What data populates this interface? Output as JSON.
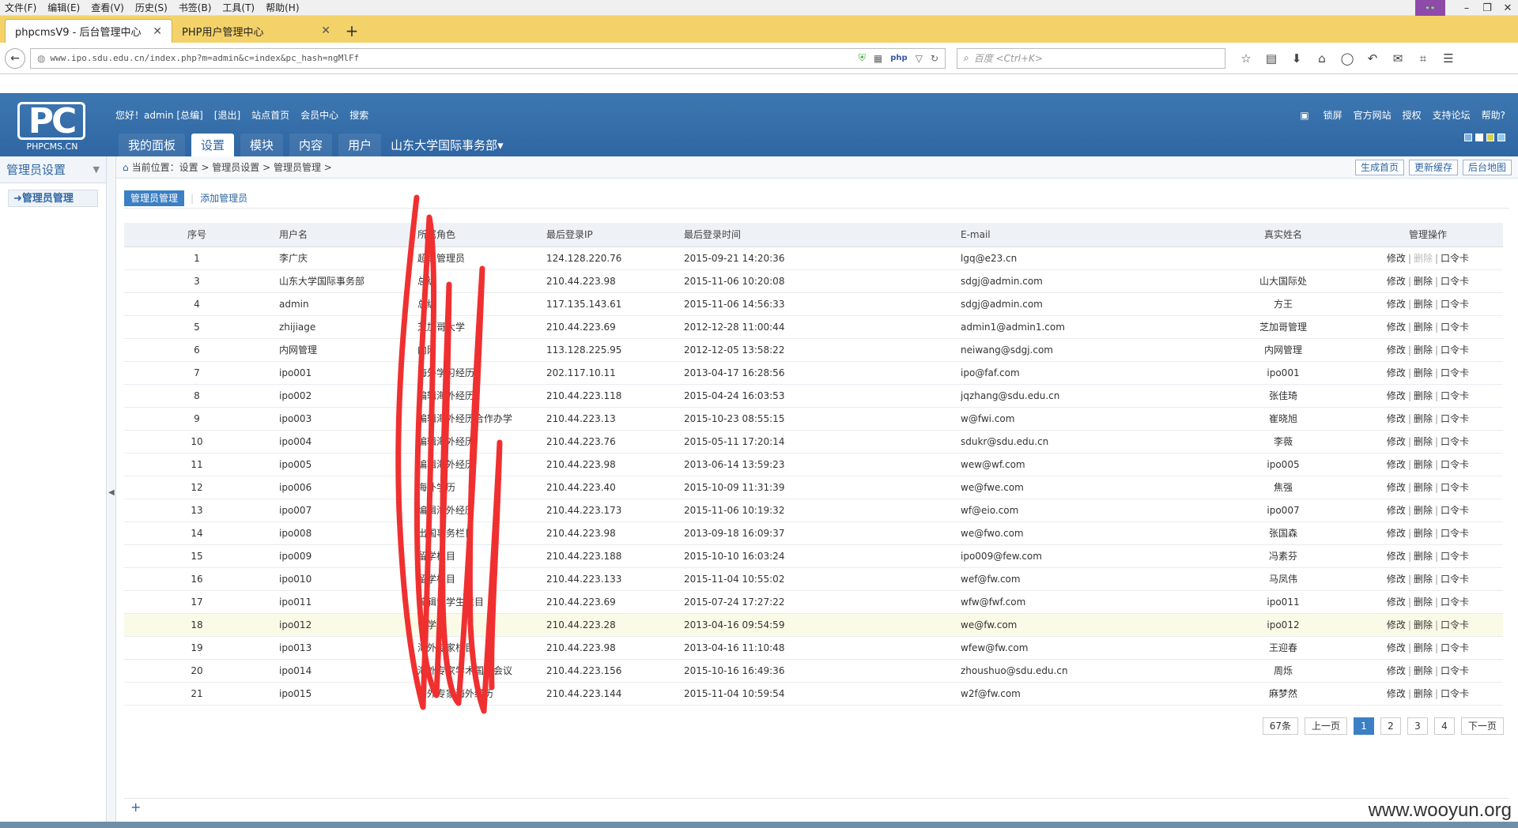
{
  "browser": {
    "menu": [
      "文件(F)",
      "编辑(E)",
      "查看(V)",
      "历史(S)",
      "书签(B)",
      "工具(T)",
      "帮助(H)"
    ],
    "tabs": [
      {
        "label": "phpcmsV9 - 后台管理中心"
      },
      {
        "label": "PHP用户管理中心"
      }
    ],
    "new_tab": "+",
    "url": "www.ipo.sdu.edu.cn/index.php?m=admin&c=index&pc_hash=ngMlFf",
    "search_placeholder": "百度 <Ctrl+K>",
    "mask_icon": "👓"
  },
  "app": {
    "logo_big": "PC",
    "logo_small": "PHPCMS.CN",
    "user_links": [
      "您好！admin [总编]",
      "[退出]",
      "站点首页",
      "会员中心",
      "搜索"
    ],
    "top_links": [
      "锁屏",
      "官方网站",
      "授权",
      "支持论坛",
      "帮助?"
    ],
    "main_nav": [
      {
        "label": "我的面板"
      },
      {
        "label": "设置"
      },
      {
        "label": "模块"
      },
      {
        "label": "内容"
      },
      {
        "label": "用户"
      }
    ],
    "dept": "山东大学国际事务部▾",
    "skin_colors": [
      "#7fb0e0",
      "#ffffff",
      "#d8d24a",
      "#8fc9ef"
    ]
  },
  "sidebar": {
    "title": "管理员设置",
    "items": [
      {
        "label": "➜管理员管理"
      }
    ]
  },
  "breadcrumb": {
    "text": "当前位置：设置 > 管理员设置 > 管理员管理 >",
    "buttons": [
      "生成首页",
      "更新缓存",
      "后台地图"
    ]
  },
  "subnav": {
    "active": "管理员管理",
    "other": "添加管理员"
  },
  "table": {
    "headers": [
      "序号",
      "用户名",
      "所属角色",
      "最后登录IP",
      "最后登录时间",
      "E-mail",
      "真实姓名",
      "管理操作"
    ],
    "rows": [
      {
        "id": "1",
        "user": "李广庆",
        "role": "超级管理员",
        "ip": "124.128.220.76",
        "time": "2015-09-21 14:20:36",
        "email": "lgq@e23.cn",
        "name": "",
        "del_disabled": true
      },
      {
        "id": "3",
        "user": "山东大学国际事务部",
        "role": "总编",
        "ip": "210.44.223.98",
        "time": "2015-11-06 10:20:08",
        "email": "sdgj@admin.com",
        "name": "山大国际处"
      },
      {
        "id": "4",
        "user": "admin",
        "role": "总编",
        "ip": "117.135.143.61",
        "time": "2015-11-06 14:56:33",
        "email": "sdgj@admin.com",
        "name": "方王"
      },
      {
        "id": "5",
        "user": "zhijiage",
        "role": "芝加哥大学",
        "ip": "210.44.223.69",
        "time": "2012-12-28 11:00:44",
        "email": "admin1@admin1.com",
        "name": "芝加哥管理"
      },
      {
        "id": "6",
        "user": "内网管理",
        "role": "内网",
        "ip": "113.128.225.95",
        "time": "2012-12-05 13:58:22",
        "email": "neiwang@sdgj.com",
        "name": "内网管理"
      },
      {
        "id": "7",
        "user": "ipo001",
        "role": "海外学习经历",
        "ip": "202.117.10.11",
        "time": "2013-04-17 16:28:56",
        "email": "ipo@faf.com",
        "name": "ipo001"
      },
      {
        "id": "8",
        "user": "ipo002",
        "role": "编辑海外经历",
        "ip": "210.44.223.118",
        "time": "2015-04-24 16:03:53",
        "email": "jqzhang@sdu.edu.cn",
        "name": "张佳琦"
      },
      {
        "id": "9",
        "user": "ipo003",
        "role": "编辑海外经历合作办学",
        "ip": "210.44.223.13",
        "time": "2015-10-23 08:55:15",
        "email": "w@fwi.com",
        "name": "崔晓旭"
      },
      {
        "id": "10",
        "user": "ipo004",
        "role": "编辑海外经历",
        "ip": "210.44.223.76",
        "time": "2015-05-11 17:20:14",
        "email": "sdukr@sdu.edu.cn",
        "name": "李薇"
      },
      {
        "id": "11",
        "user": "ipo005",
        "role": "编辑海外经历",
        "ip": "210.44.223.98",
        "time": "2013-06-14 13:59:23",
        "email": "wew@wf.com",
        "name": "ipo005"
      },
      {
        "id": "12",
        "user": "ipo006",
        "role": "海外学历",
        "ip": "210.44.223.40",
        "time": "2015-10-09 11:31:39",
        "email": "we@fwe.com",
        "name": "焦强"
      },
      {
        "id": "13",
        "user": "ipo007",
        "role": "编辑海外经历",
        "ip": "210.44.223.173",
        "time": "2015-11-06 10:19:32",
        "email": "wf@eio.com",
        "name": "ipo007"
      },
      {
        "id": "14",
        "user": "ipo008",
        "role": "出国事务栏目",
        "ip": "210.44.223.98",
        "time": "2013-09-18 16:09:37",
        "email": "we@fwo.com",
        "name": "张国森"
      },
      {
        "id": "15",
        "user": "ipo009",
        "role": "留学栏目",
        "ip": "210.44.223.188",
        "time": "2015-10-10 16:03:24",
        "email": "ipo009@few.com",
        "name": "冯素芬"
      },
      {
        "id": "16",
        "user": "ipo010",
        "role": "留学栏目",
        "ip": "210.44.223.133",
        "time": "2015-11-04 10:55:02",
        "email": "wef@fw.com",
        "name": "马凤伟"
      },
      {
        "id": "17",
        "user": "ipo011",
        "role": "编辑留学生栏目",
        "ip": "210.44.223.69",
        "time": "2015-07-24 17:27:22",
        "email": "wfw@fwf.com",
        "name": "ipo011"
      },
      {
        "id": "18",
        "user": "ipo012",
        "role": "留学",
        "ip": "210.44.223.28",
        "time": "2013-04-16 09:54:59",
        "email": "we@fw.com",
        "name": "ipo012",
        "highlight": true
      },
      {
        "id": "19",
        "user": "ipo013",
        "role": "海外专家栏目",
        "ip": "210.44.223.98",
        "time": "2013-04-16 11:10:48",
        "email": "wfew@fw.com",
        "name": "王迎春"
      },
      {
        "id": "20",
        "user": "ipo014",
        "role": "海外专家学术国际会议",
        "ip": "210.44.223.156",
        "time": "2015-10-16 16:49:36",
        "email": "zhoushuo@sdu.edu.cn",
        "name": "周烁"
      },
      {
        "id": "21",
        "user": "ipo015",
        "role": "海外专家海外经历",
        "ip": "210.44.223.144",
        "time": "2015-11-04 10:59:54",
        "email": "w2f@fw.com",
        "name": "麻梦然"
      }
    ],
    "ops": {
      "edit": "修改",
      "del": "删除",
      "token": "口令卡"
    }
  },
  "pager": {
    "total": "67条",
    "prev": "上一页",
    "pages": [
      "1",
      "2",
      "3",
      "4"
    ],
    "current": "1",
    "next": "下一页"
  },
  "add_icon": "+",
  "watermark": "www.wooyun.org"
}
